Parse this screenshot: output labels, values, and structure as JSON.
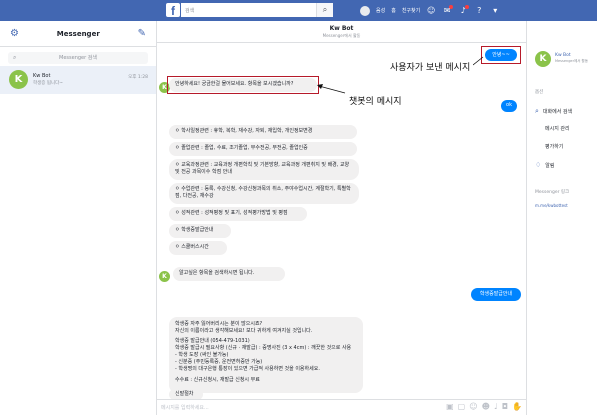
{
  "topbar": {
    "logo": "f",
    "search_placeholder": "검색",
    "search_icon": "search-icon",
    "profile_label": "음성",
    "home_label": "홈",
    "friends_label": "친구찾기"
  },
  "left": {
    "title": "Messenger",
    "search_placeholder": "Messenger 검색",
    "conversation": {
      "initial": "K",
      "name": "Kw Bot",
      "last": "학생증 됩니다~",
      "time": "오후 1:28"
    }
  },
  "chat": {
    "name": "Kw Bot",
    "subtitle": "Messenger에서 활동",
    "user_msg": "안녕~~",
    "annotation_user": "사용자가 보낸 메시지",
    "annotation_bot": "챗봇의 메시지",
    "bot_greeting": "안녕하세요! 궁금한걸 물어보세요. 항목을 보시겠습니까?",
    "ok_msg": "ok",
    "menu": [
      "ㅇ 학사일정관련 : 휴학, 복학, 재수강, 자퇴, 재입학, 개인정보변경",
      "ㅇ 졸업관련 : 졸업, 수료, 조기졸업, 부수전공, 부전공, 졸업인증",
      "ㅇ 교육과정관련 : 교육과정 개편학칙 및 기본방향, 교육과정 개편취지 및 배경, 교양 및 전공 과목이수 학점 안내",
      "ㅇ 수업관련 : 등록, 수강신청, 수강신청과목의 취소, 주야수업시간, 계절학기, 특별학점, 다전공, 재수강",
      "ㅇ 성적관련 : 성적평정 및 표기, 성적평가방법 및 평점",
      "ㅇ 학생증발급안내",
      "ㅇ 스쿨버스시간"
    ],
    "bot_prompt": "알고싶은 항목을 검색하시면 됩니다.",
    "user_msg2": "학생증발급안내",
    "bot_card_lines": [
      "학생증 자주 잃어버리시는 분이 많으시죠?",
      "자신의 이름이라고 생각해보세요! 보다 귀하게 여겨지실 것입니다.",
      "",
      "학생증 발급안내 (054-479-1031)",
      "학생증 발급시 필요사항 (신규 · 재발급) : 증명사진 (3 x 4cm) : 깨끗한 것으로 사용",
      "- 학생 도장 (싸인 불가능)",
      "- 신분증 (주민등록증, 운전면허증만 가능)",
      "- 학생명의 대구은행 통장이 있으면 가급적 사용하면 것을 이용하세요.",
      "",
      "수수료 : 신규신청시, 재발급 신청시 무료"
    ],
    "bot_last": "신발절차",
    "composer_placeholder": "메시지를 입력하세요..."
  },
  "right": {
    "initial": "K",
    "name": "Kw Bot",
    "sub": "Messenger에서 활동",
    "section_options": "옵션",
    "item_search": "대화에서 검색",
    "item_manage": "메시지 관리",
    "item_rate": "평가하기",
    "item_alert": "알림",
    "section_link": "Messenger 링크",
    "link": "m.me/kwbottest"
  },
  "colors": {
    "brand": "#4267b2",
    "bubble_user": "#0084ff",
    "bubble_bot": "#f1f0f0",
    "annotation_box": "#b61a2a"
  }
}
